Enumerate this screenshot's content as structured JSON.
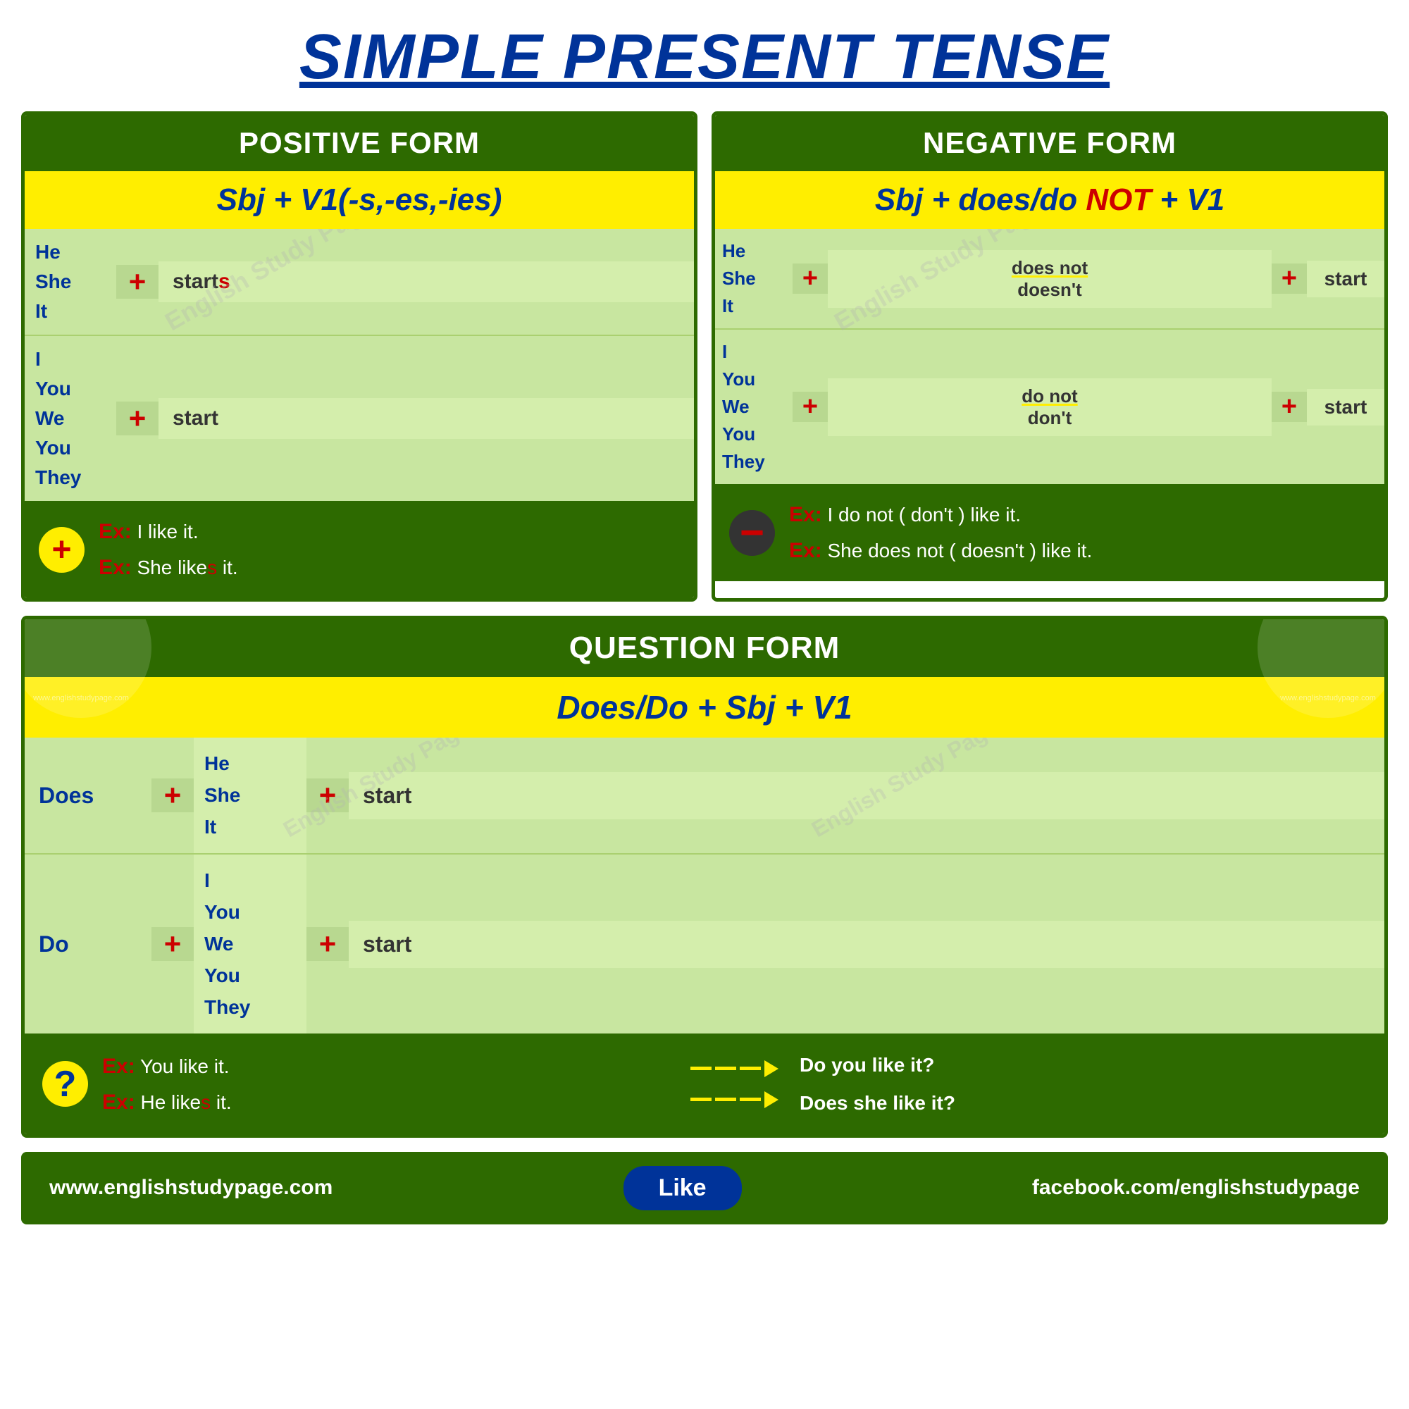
{
  "title": "SIMPLE PRESENT TENSE",
  "positive": {
    "header": "POSITIVE FORM",
    "formula": "Sbj + V1(-s,-es,-ies)",
    "rows": [
      {
        "subjects": [
          "He",
          "She",
          "It"
        ],
        "plus": "+",
        "verb": "start",
        "verb_suffix": "s"
      },
      {
        "subjects": [
          "I",
          "You",
          "We",
          "You",
          "They"
        ],
        "plus": "+",
        "verb": "start",
        "verb_suffix": ""
      }
    ],
    "badge": "+",
    "example1_label": "Ex:",
    "example1": " I like it.",
    "example2_label": "Ex:",
    "example2_pre": " She like",
    "example2_s": "s",
    "example2_post": " it."
  },
  "negative": {
    "header": "NEGATIVE FORM",
    "formula_pre": "Sbj + does/do ",
    "formula_not": "NOT",
    "formula_post": " + V1",
    "rows": [
      {
        "subjects": [
          "He",
          "She",
          "It"
        ],
        "plus": "+",
        "aux1": "does not",
        "aux2": "doesn't",
        "plus2": "+",
        "verb": "start"
      },
      {
        "subjects": [
          "I",
          "You",
          "We",
          "You",
          "They"
        ],
        "plus": "+",
        "aux1": "do not",
        "aux2": "don't",
        "plus2": "+",
        "verb": "start"
      }
    ],
    "badge": "−",
    "example1_label": "Ex:",
    "example1": " I do not ( don't ) like it.",
    "example2_label": "Ex:",
    "example2": " She does not ( doesn't ) like it."
  },
  "question": {
    "header": "QUESTION FORM",
    "formula": "Does/Do +  Sbj + V1",
    "rows": [
      {
        "aux": "Does",
        "plus": "+",
        "subjects": [
          "He",
          "She",
          "It"
        ],
        "plus2": "+",
        "verb": "start"
      },
      {
        "aux": "Do",
        "plus": "+",
        "subjects": [
          "I",
          "You",
          "We",
          "You",
          "They"
        ],
        "plus2": "+",
        "verb": "start"
      }
    ],
    "badge": "?",
    "example1_label": "Ex:",
    "example1": " You like it.",
    "example2_label": "Ex:",
    "example2_pre": " He like",
    "example2_s": "s",
    "example2_post": " it.",
    "answer1": "Do you like it?",
    "answer2": "Does she like it?"
  },
  "footer": {
    "left": "www.englishstudypage.com",
    "like": "Like",
    "right": "facebook.com/englishstudypage"
  },
  "watermark": "English Study Page"
}
